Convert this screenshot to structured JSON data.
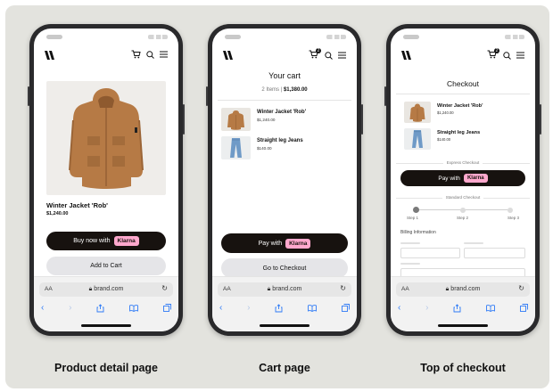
{
  "captions": {
    "pdp": "Product detail page",
    "cart": "Cart page",
    "checkout": "Top of checkout"
  },
  "browser": {
    "aa": "AA",
    "url": "brand.com",
    "lock_icon": "lock-icon",
    "reload_icon": "reload-icon"
  },
  "pdp": {
    "product_name": "Winter Jacket 'Rob'",
    "product_price": "$1,240.00",
    "buy_now_label": "Buy now with",
    "klarna_label": "Klarna",
    "add_to_cart_label": "Add to Cart"
  },
  "cart": {
    "title": "Your cart",
    "items_count": "2 Items |",
    "total": "$1,380.00",
    "items": [
      {
        "name": "Winter Jacket 'Rob'",
        "price": "$1,240.00"
      },
      {
        "name": "Straight leg Jeans",
        "price": "$140.00"
      }
    ],
    "cart_badge": "2",
    "pay_with_label": "Pay with",
    "klarna_label": "Klarna",
    "checkout_label": "Go to Checkout"
  },
  "checkout": {
    "title": "Checkout",
    "items": [
      {
        "name": "Winter Jacket 'Rob'",
        "price": "$1,240.00"
      },
      {
        "name": "Straight leg Jeans",
        "price": "$140.00"
      }
    ],
    "cart_badge": "2",
    "express_label": "Express Checkout",
    "pay_with_label": "Pay with",
    "klarna_label": "Klarna",
    "standard_label": "Standard Checkout",
    "steps": [
      "Step 1",
      "Step 2",
      "Step 3"
    ],
    "billing_label": "Billing Information"
  },
  "colors": {
    "board": "#e3e3de",
    "klarna_pink": "#ffa8cd",
    "button_dark": "#17120f",
    "button_light": "#e5e5e8",
    "safari_blue": "#2f7bf6"
  }
}
